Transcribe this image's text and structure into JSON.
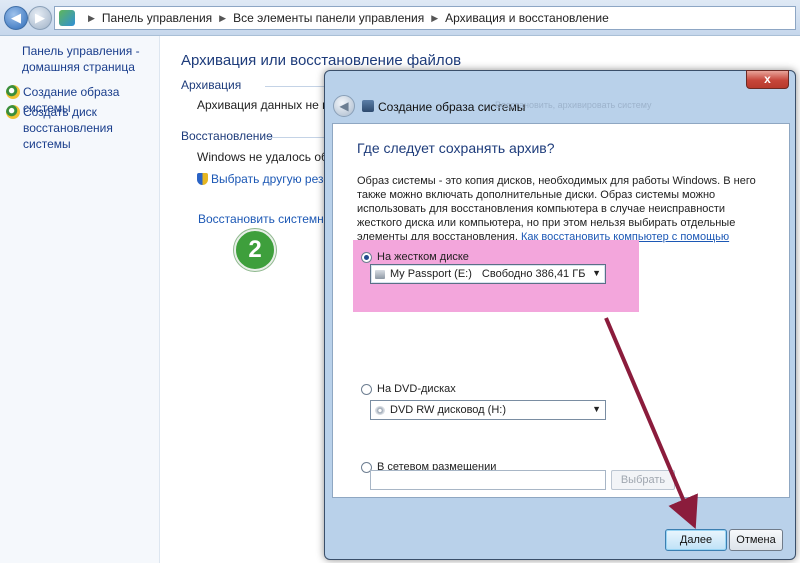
{
  "address_bar": {
    "back_icon": "back-arrow-icon",
    "forward_icon": "forward-arrow-icon",
    "crumbs": [
      "Панель управления",
      "Все элементы панели управления",
      "Архивация и восстановление"
    ]
  },
  "left_pane": {
    "home_link": "Панель управления - домашняя страница",
    "tasks": [
      {
        "label": "Создание образа системы",
        "icon": "shield-icon"
      },
      {
        "label": "Создать диск восстановления системы",
        "icon": "shield-icon"
      }
    ]
  },
  "main": {
    "title": "Архивация или восстановление файлов",
    "backup_heading": "Архивация",
    "backup_status": "Архивация данных не настр",
    "restore_heading": "Восстановление",
    "restore_status": "Windows не удалось обнару",
    "choose_backup_link": "Выбрать другую резервну",
    "restore_settings_link": "Восстановить системные па"
  },
  "step_badge": "2",
  "dialog": {
    "close_label": "x",
    "title": "Создание образа системы",
    "ghost_title": "Восстановить, архивировать систему",
    "heading": "Где следует сохранять архив?",
    "description": "Образ системы - это копия дисков, необходимых для работы Windows. В него также можно включать дополнительные диски. Образ системы можно использовать для восстановления компьютера в случае неисправности жесткого диска или компьютера, но при этом нельзя выбирать отдельные элементы для восстановления.",
    "help_link": "Как восстановить компьютер с помощью образа системы?",
    "options": {
      "hard_disk": {
        "label": "На жестком диске",
        "selected": true,
        "drive": "My Passport (E:)",
        "free_space": "Свободно 386,41 ГБ"
      },
      "dvd": {
        "label": "На DVD-дисках",
        "selected": false,
        "drive": "DVD RW дисковод (H:)"
      },
      "network": {
        "label": "В сетевом размещении",
        "selected": false,
        "path": "",
        "browse_label": "Выбрать"
      }
    },
    "next_button": "Далее",
    "cancel_button": "Отмена"
  },
  "colors": {
    "highlight": "#f3a6dc",
    "arrow": "#8b1c3c",
    "badge": "#3e9f3c",
    "link": "#1c58b5"
  }
}
